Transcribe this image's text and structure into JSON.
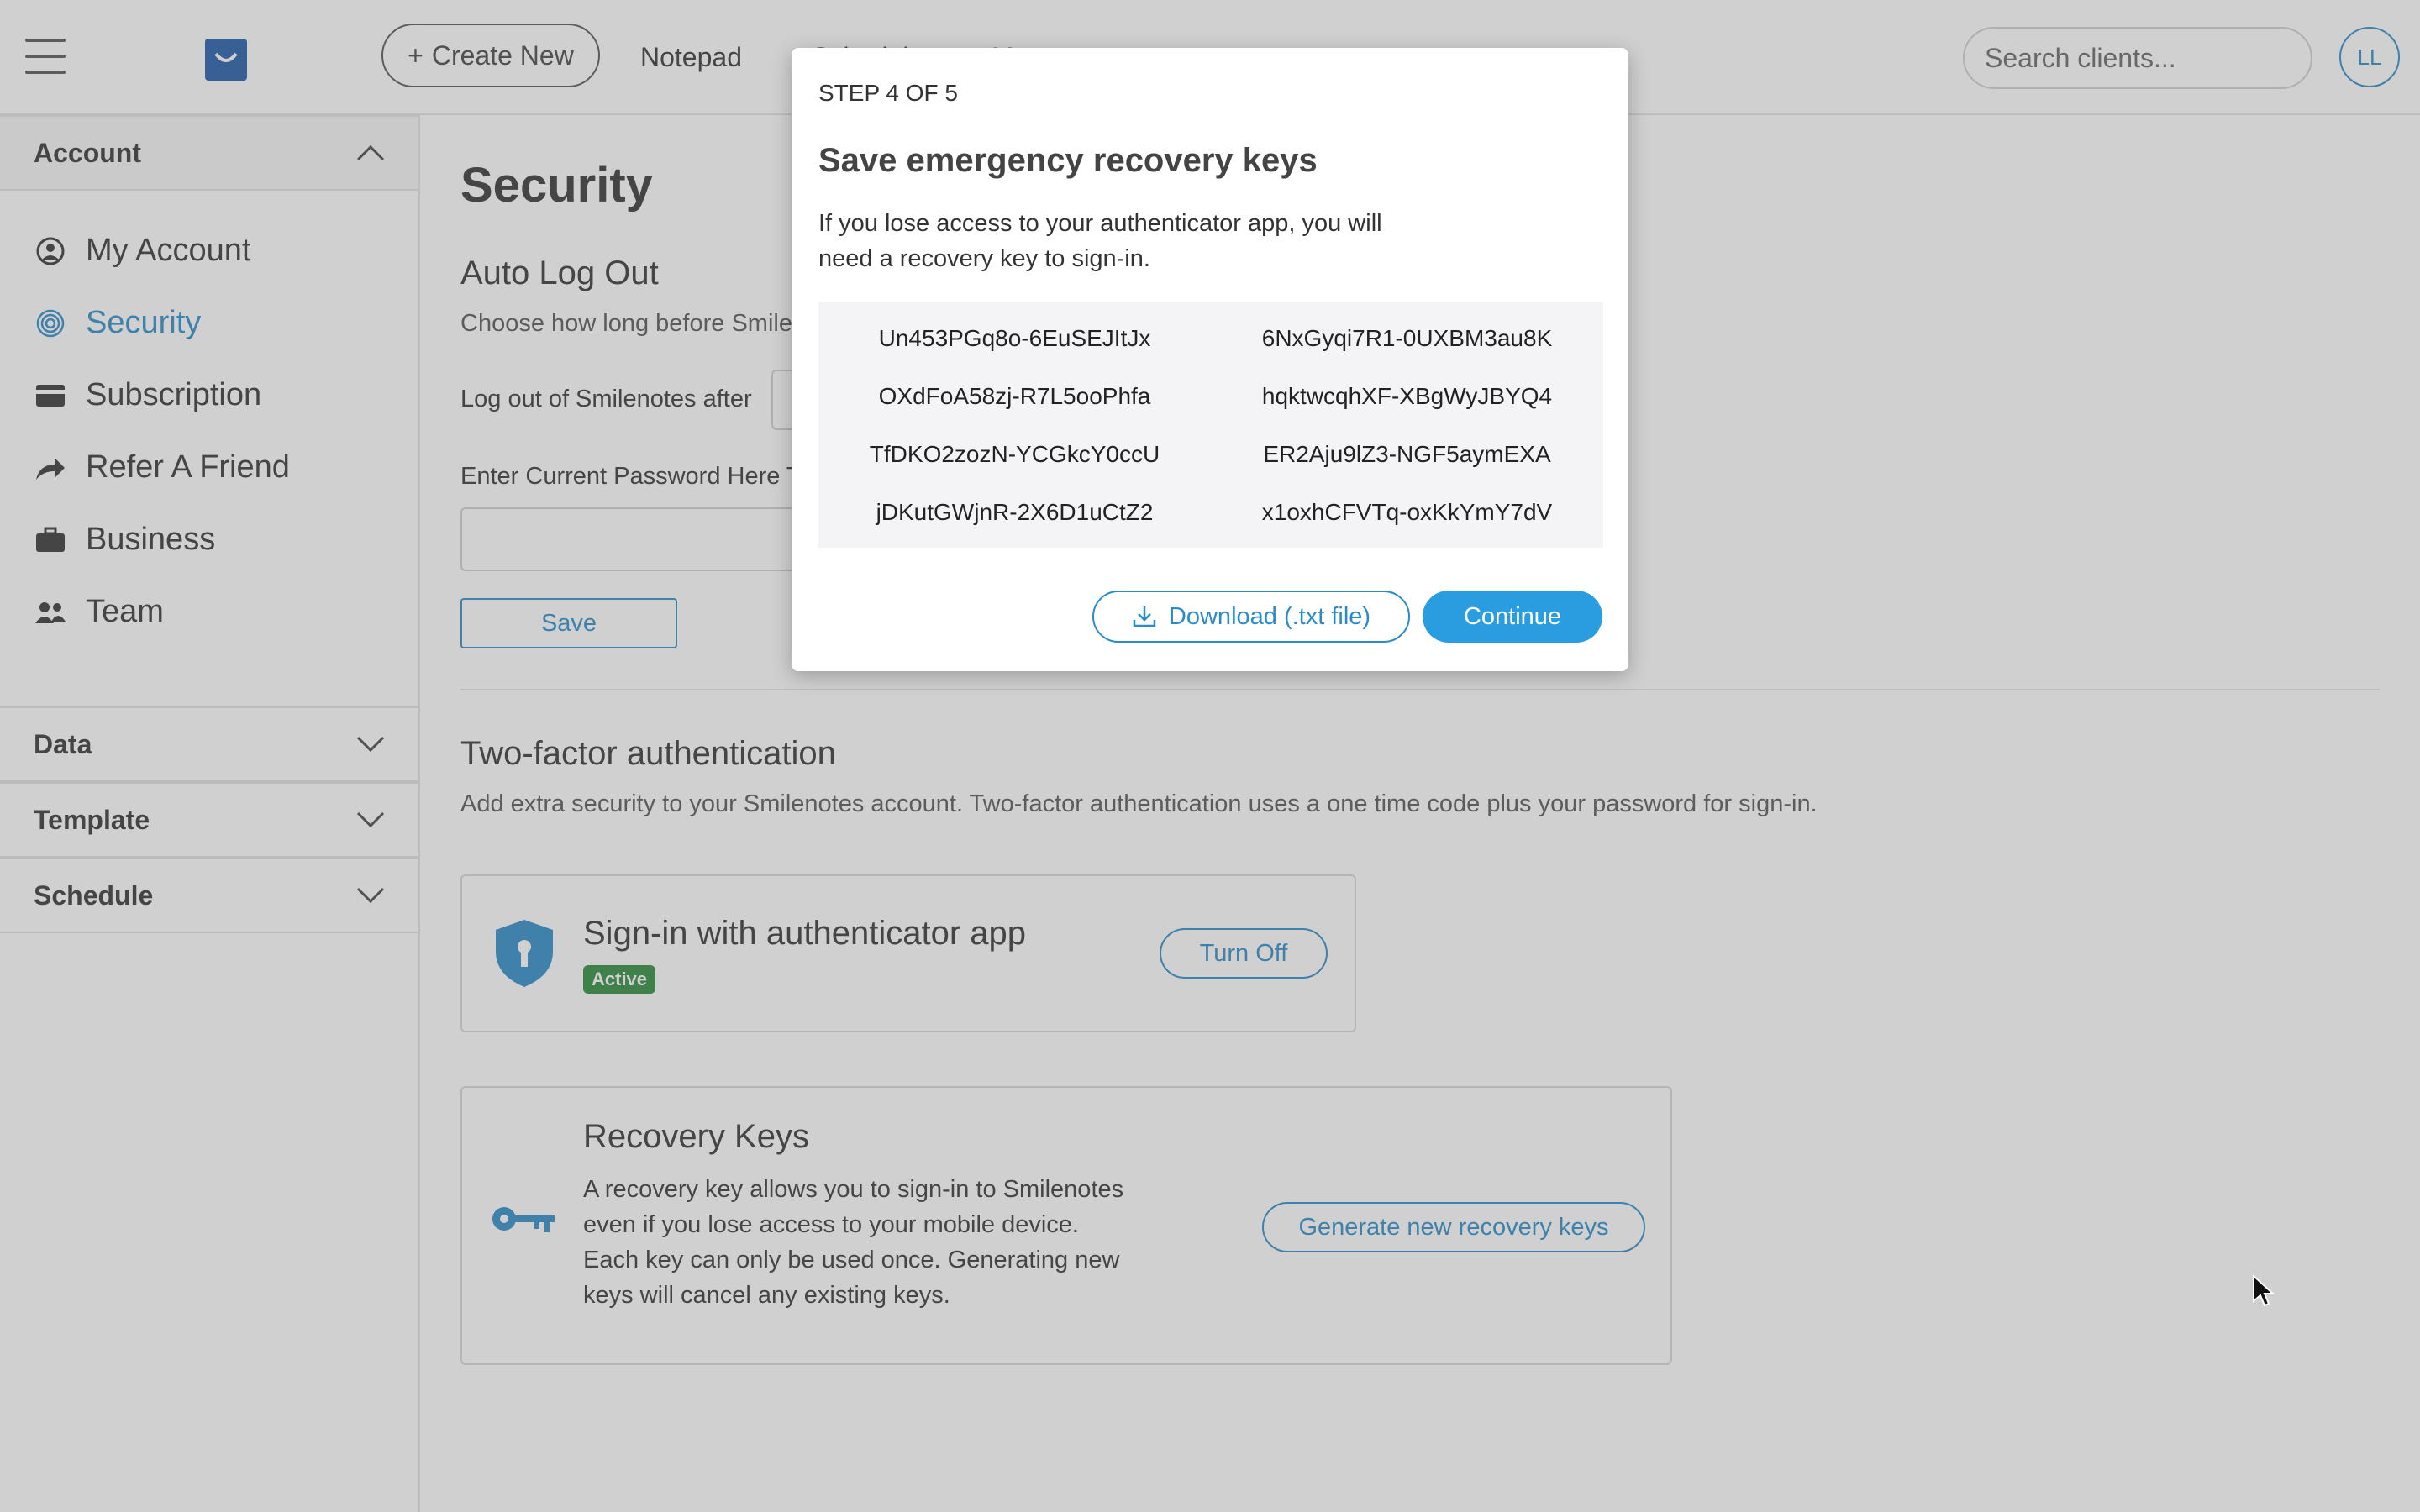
{
  "topbar": {
    "create_label": "Create New",
    "nav": [
      "Notepad",
      "Schedule",
      "Messages"
    ],
    "search_placeholder": "Search clients...",
    "avatar_initials": "LL"
  },
  "sidebar": {
    "account_header": "Account",
    "items": [
      {
        "label": "My Account",
        "icon": "user-circle-icon"
      },
      {
        "label": "Security",
        "icon": "fingerprint-icon",
        "active": true
      },
      {
        "label": "Subscription",
        "icon": "credit-card-icon"
      },
      {
        "label": "Refer A Friend",
        "icon": "share-arrow-icon"
      },
      {
        "label": "Business",
        "icon": "briefcase-icon"
      },
      {
        "label": "Team",
        "icon": "team-icon"
      }
    ],
    "sections": [
      "Data",
      "Template",
      "Schedule"
    ]
  },
  "main": {
    "title": "Security",
    "auto_logout": {
      "heading": "Auto Log Out",
      "description": "Choose how long before Smilenotes",
      "logout_label": "Log out of Smilenotes after",
      "password_label": "Enter Current Password Here To",
      "save_label": "Save"
    },
    "two_factor": {
      "heading": "Two-factor authentication",
      "description": "Add extra security to your Smilenotes account. Two-factor authentication uses a one time code plus your password for sign-in.",
      "app_title": "Sign-in with authenticator app",
      "app_status": "Active",
      "turn_off_label": "Turn Off"
    },
    "recovery": {
      "heading": "Recovery Keys",
      "description": "A recovery key allows you to sign-in to Smilenotes even if you lose access to your mobile device. Each key can only be used once. Generating new keys will cancel any existing keys.",
      "generate_label": "Generate new recovery keys"
    }
  },
  "modal": {
    "step": "STEP 4 OF 5",
    "title": "Save emergency recovery keys",
    "description": "If you lose access to your authenticator app, you will need a recovery key to sign-in.",
    "keys": [
      "Un453PGq8o-6EuSEJItJx",
      "6NxGyqi7R1-0UXBM3au8K",
      "OXdFoA58zj-R7L5ooPhfa",
      "hqktwcqhXF-XBgWyJBYQ4",
      "TfDKO2zozN-YCGkcY0ccU",
      "ER2Aju9lZ3-NGF5aymEXA",
      "jDKutGWjnR-2X6D1uCtZ2",
      "x1oxhCFVTq-oxKkYmY7dV"
    ],
    "download_label": "Download (.txt file)",
    "continue_label": "Continue"
  },
  "colors": {
    "accent": "#2a8bc9",
    "continue_bg": "#2a9de0",
    "active_badge": "#2c8a3a",
    "brand": "#1f5aa8"
  }
}
